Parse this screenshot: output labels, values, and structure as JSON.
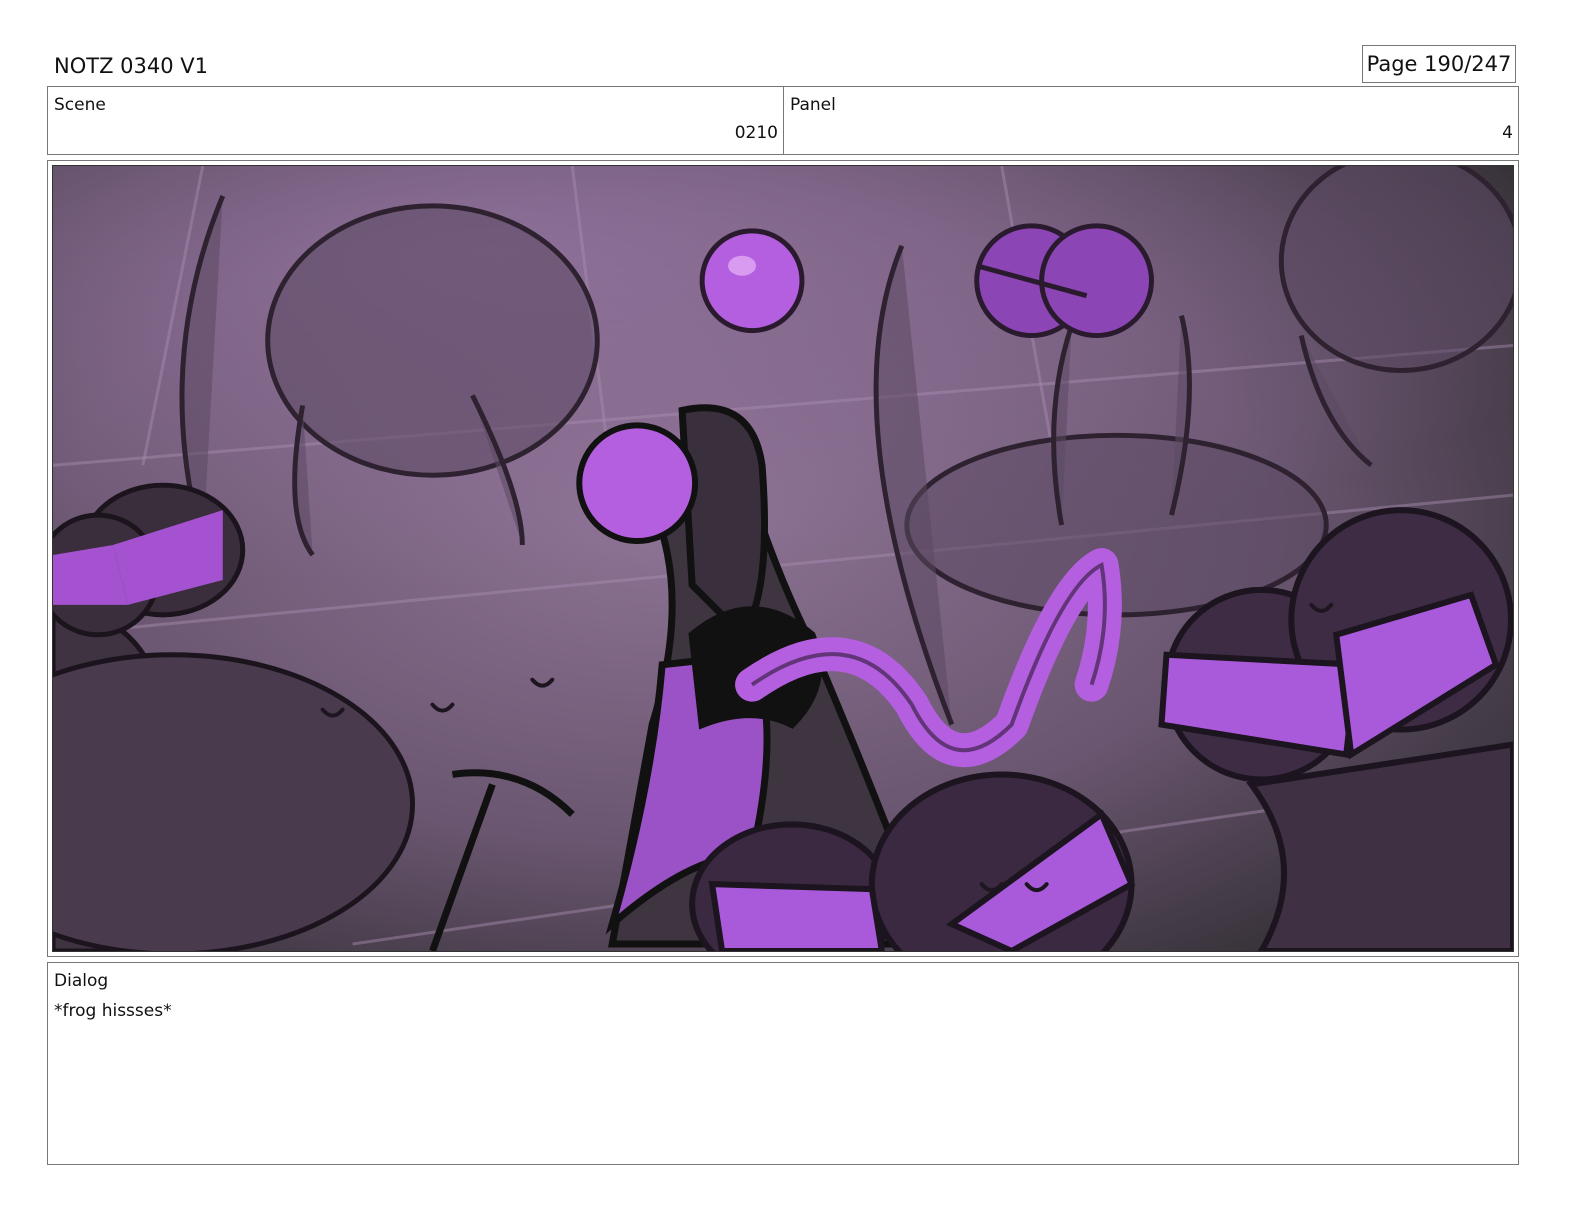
{
  "header": {
    "title": "NOTZ 0340 V1",
    "page": "Page 190/247"
  },
  "info": {
    "scene_label": "Scene",
    "scene_value": "0210",
    "panel_label": "Panel",
    "panel_value": "4"
  },
  "artwork": {
    "accent_purple": "#b45ee0",
    "shadow_purple": "#3a2a42",
    "background_purple": "#7a5a8a"
  },
  "dialog": {
    "label": "Dialog",
    "text": "*frog hissses*"
  }
}
